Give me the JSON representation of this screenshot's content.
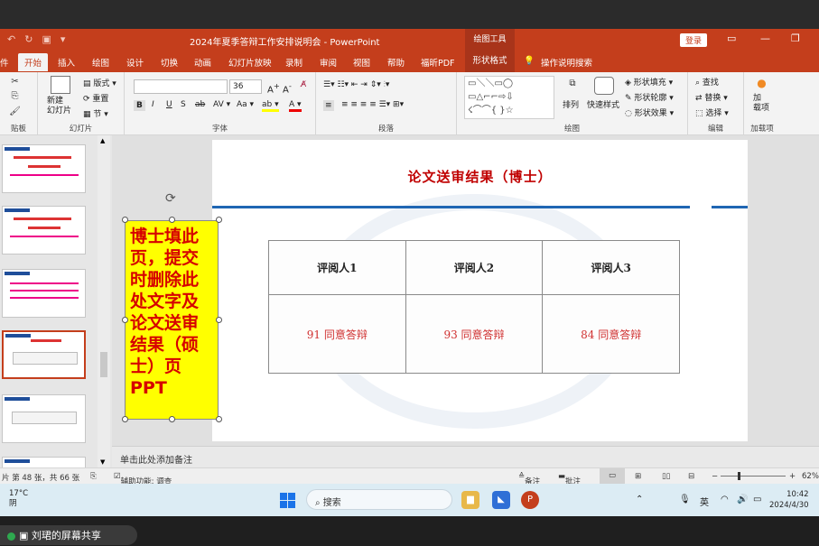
{
  "window": {
    "title": "2024年夏季答辩工作安排说明会 - PowerPoint",
    "context_tools_label": "绘图工具",
    "login_label": "登录"
  },
  "tabs": [
    "件",
    "开始",
    "插入",
    "绘图",
    "设计",
    "切换",
    "动画",
    "幻灯片放映",
    "录制",
    "审阅",
    "视图",
    "帮助",
    "福昕PDF",
    "形状格式",
    "操作说明搜索"
  ],
  "ribbon": {
    "clipboard_label": "贴板",
    "new_slide_label": "新建\n幻灯片",
    "layout_label": "版式",
    "reset_label": "重置",
    "section_label": "节",
    "slides_group_label": "幻灯片",
    "font_size": "36",
    "font_group_label": "字体",
    "paragraph_group_label": "段落",
    "drawing_group_label": "绘图",
    "arrange_label": "排列",
    "quick_styles_label": "快速样式",
    "shape_fill_label": "形状填充",
    "shape_outline_label": "形状轮廓",
    "shape_effects_label": "形状效果",
    "find_label": "查找",
    "replace_label": "替换",
    "select_label": "选择",
    "editing_group_label": "编辑",
    "addins_label": "加\n载项",
    "addins_group_label": "加载项"
  },
  "slide": {
    "title": "论文送审结果（博士）",
    "table": {
      "headers": [
        "评阅人1",
        "评阅人2",
        "评阅人3"
      ],
      "rows": [
        [
          "91  同意答辩",
          "93 同意答辩",
          "84 同意答辩"
        ]
      ]
    },
    "note_text": "博士填此页，提交时删除此处文字及论文送审结果（硕士）页PPT"
  },
  "notes_placeholder": "单击此处添加备注",
  "status": {
    "slide_count": "片 第 48 张，共 66 张",
    "accessibility": "辅助功能: 调查",
    "notes_btn": "备注",
    "comments_btn": "批注",
    "zoom": "62%"
  },
  "taskbar": {
    "weather_temp": "17°C",
    "weather_desc": "阴",
    "search_placeholder": "搜索",
    "ime": "英",
    "time": "10:42",
    "date": "2024/4/30"
  },
  "share": {
    "label": "刘珺的屏幕共享"
  }
}
